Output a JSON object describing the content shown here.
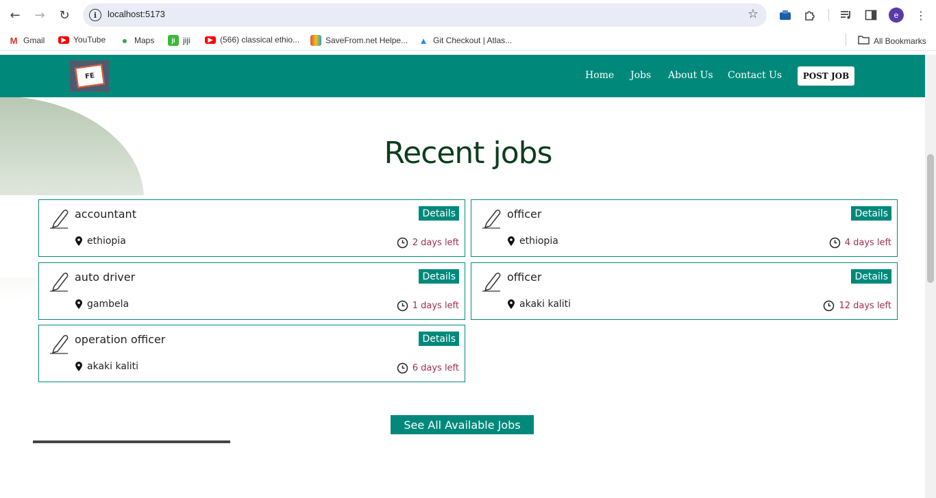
{
  "browser": {
    "url": "localhost:5173",
    "profile_initial": "e",
    "bookmarks": [
      {
        "label": "Gmail",
        "icon": "gmail-icon"
      },
      {
        "label": "YouTube",
        "icon": "youtube-icon"
      },
      {
        "label": "Maps",
        "icon": "maps-icon"
      },
      {
        "label": "jiji",
        "icon": "jiji-icon"
      },
      {
        "label": "(566) classical ethio...",
        "icon": "youtube-icon"
      },
      {
        "label": "SaveFrom.net Helpe...",
        "icon": "savefrom-icon"
      },
      {
        "label": "Git Checkout | Atlas...",
        "icon": "atlassian-icon"
      }
    ],
    "all_bookmarks": "All Bookmarks"
  },
  "site": {
    "logo_text": "FE",
    "nav": [
      "Home",
      "Jobs",
      "About Us",
      "Contact Us"
    ],
    "post_job": "POST JOB",
    "accent": "#00897b"
  },
  "main": {
    "heading": "Recent jobs",
    "details_label": "Details",
    "jobs": [
      {
        "title": "accountant",
        "location": "ethiopia",
        "days": "2 days left"
      },
      {
        "title": "officer",
        "location": "ethiopia",
        "days": "4 days left"
      },
      {
        "title": "auto driver",
        "location": "gambela",
        "days": "1 days left"
      },
      {
        "title": "officer",
        "location": "akaki kaliti",
        "days": "12 days left"
      },
      {
        "title": "operation officer",
        "location": "akaki kaliti",
        "days": "6 days left"
      }
    ],
    "see_all": "See All Available Jobs"
  }
}
